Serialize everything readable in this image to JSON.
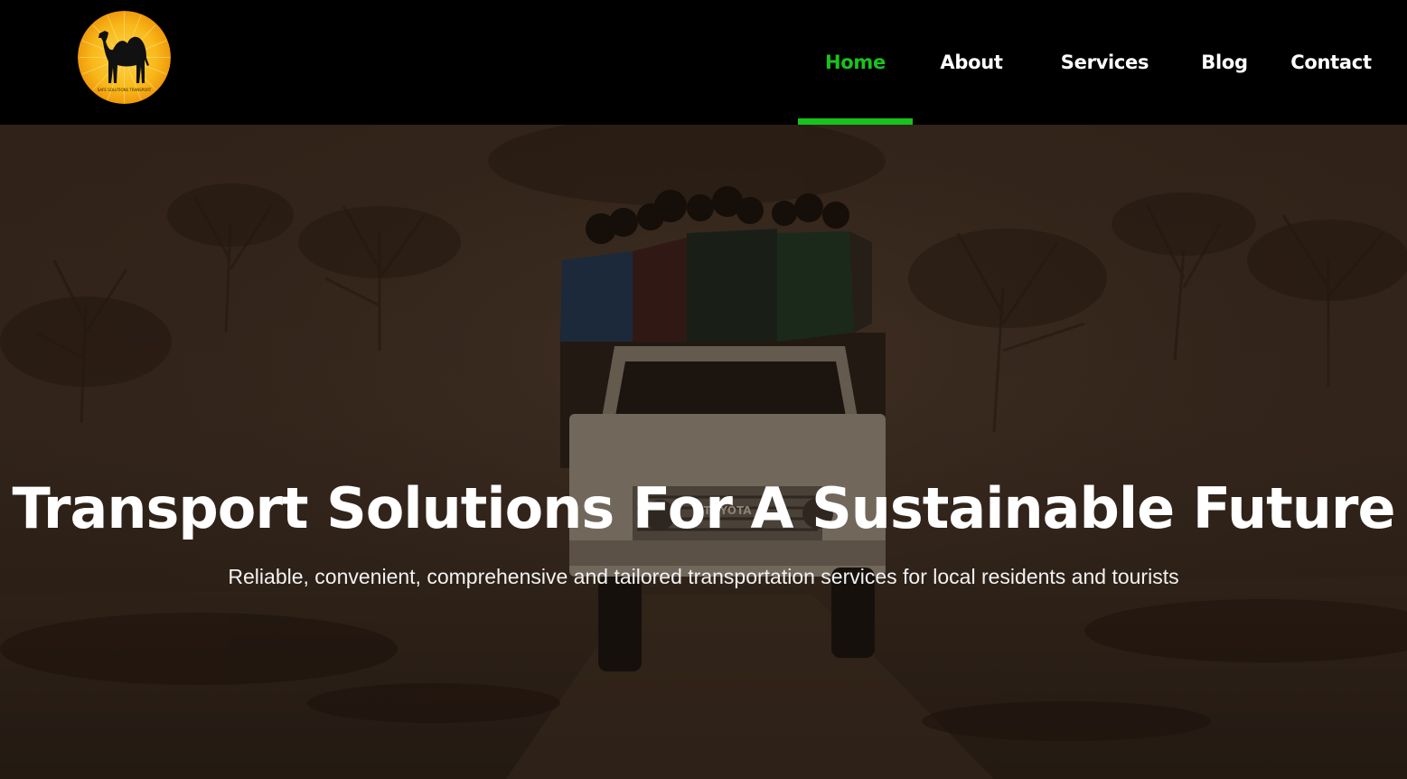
{
  "header": {
    "logo_icon": "camel-sun-logo",
    "logo_caption": "SAFE SOLUTIONS TRANSPORT",
    "nav": [
      {
        "label": "Home",
        "active": true
      },
      {
        "label": "About",
        "active": false
      },
      {
        "label": "Services",
        "active": false
      },
      {
        "label": "Blog",
        "active": false
      },
      {
        "label": "Contact",
        "active": false
      }
    ]
  },
  "hero": {
    "title": "Transport Solutions For A Sustainable Future",
    "subtitle": "Reliable, convenient, comprehensive and tailored transportation services for local residents and tourists",
    "vehicle_text": "TOYOTA"
  },
  "colors": {
    "accent": "#19c31d",
    "header_bg": "#000000",
    "text": "#ffffff",
    "logo_sun": "#f6b416"
  }
}
